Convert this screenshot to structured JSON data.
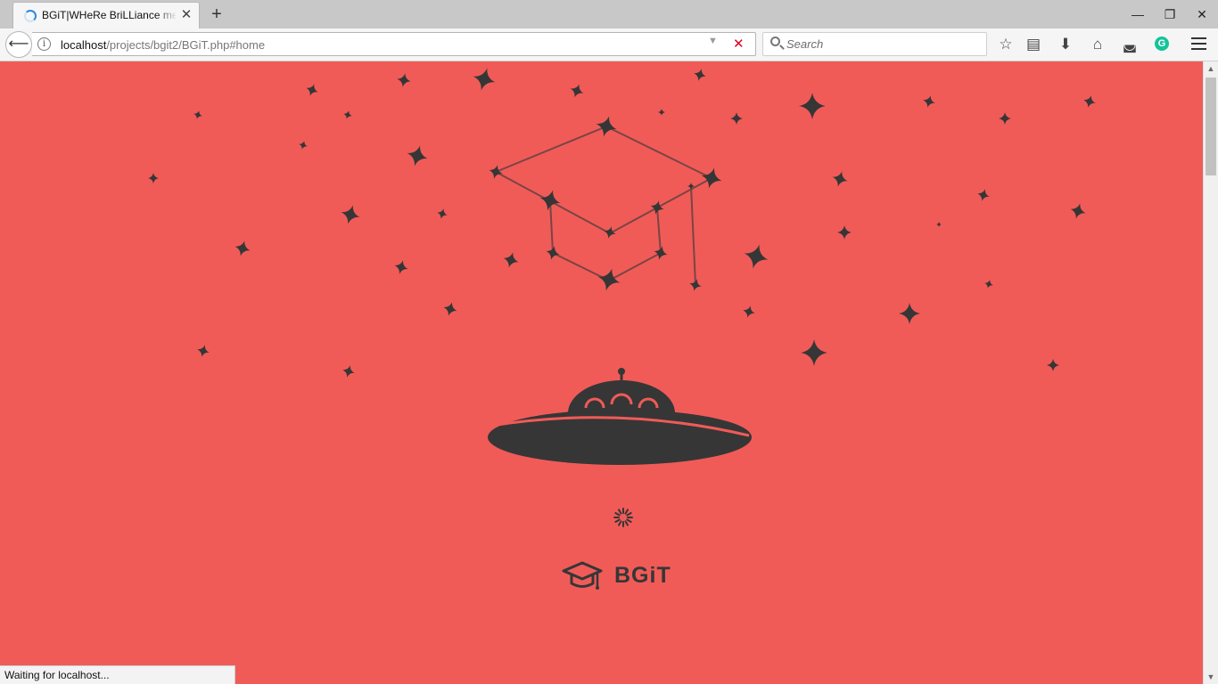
{
  "browser": {
    "tab": {
      "title": "BGiT|WHeRe BriLLiance meets"
    },
    "new_tab_label": "+",
    "window_buttons": {
      "minimize": "—",
      "restore": "❐",
      "close": "✕"
    },
    "nav": {
      "back_label": "⟵",
      "info_label": "i"
    },
    "url": {
      "host": "localhost",
      "path": "/projects/bgit2/BGiT.php#home"
    },
    "url_dropdown_label": "▼",
    "stop_label": "✕",
    "search": {
      "placeholder": "Search"
    },
    "toolbar": {
      "bookmark": "☆",
      "reader": "▤",
      "download": "⬇",
      "home": "⌂",
      "pocket": "◛",
      "grammarly": "G"
    },
    "status": "Waiting for localhost..."
  },
  "page": {
    "brand": "BGiT",
    "colors": {
      "background": "#f05b58",
      "foreground": "#363636"
    }
  }
}
